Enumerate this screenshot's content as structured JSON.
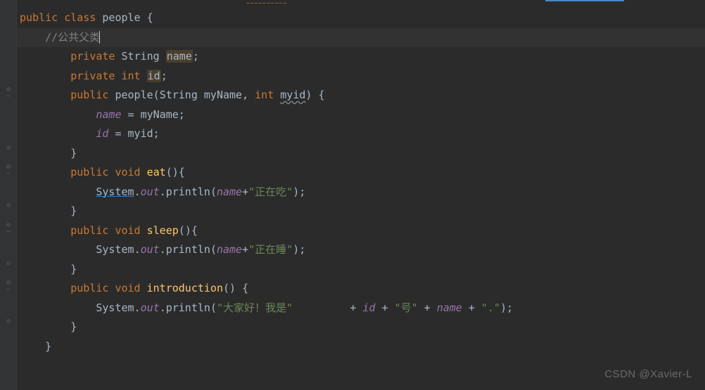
{
  "tokens": {
    "kw_public": "public",
    "kw_class": "class",
    "kw_private": "private",
    "kw_void": "void",
    "kw_int": "int",
    "cls_people": "people",
    "ty_string": "String",
    "fld_name": "name",
    "fld_id": "id",
    "p_myName": "myName",
    "p_myid": "myid",
    "m_eat": "eat",
    "m_sleep": "sleep",
    "m_intro": "introduction",
    "sys": "System",
    "out": "out",
    "println": "println",
    "comment_pub_parent": "//公共父类",
    "str_eating": "\"正在吃\"",
    "str_sleeping": "\"正在睡\"",
    "str_hello": "\"大家好！我是\"",
    "str_hao": "\"号\"",
    "str_dot": "\".\"",
    "brace_o": "{",
    "brace_c": "}",
    "paren_o": "(",
    "paren_c": ")",
    "semi": ";",
    "comma": ",",
    "dot": ".",
    "eq": "=",
    "plus": "+",
    "sp": " "
  },
  "watermark": "CSDN @Xavier-L",
  "code_lines": [
    {
      "indent": 0,
      "parts": [
        {
          "k": "kw_public",
          "c": "kw"
        },
        {
          "t": " "
        },
        {
          "k": "kw_class",
          "c": "kw"
        },
        {
          "t": " "
        },
        {
          "k": "cls_people",
          "c": "classname"
        },
        {
          "t": " "
        },
        {
          "k": "brace_o",
          "c": "punct"
        }
      ]
    },
    {
      "indent": 1,
      "hl": true,
      "parts": [
        {
          "k": "comment_pub_parent",
          "c": "comment"
        },
        {
          "t": "",
          "caret": true
        }
      ]
    },
    {
      "indent": 2,
      "parts": [
        {
          "k": "kw_private",
          "c": "kw"
        },
        {
          "t": " "
        },
        {
          "k": "ty_string",
          "c": "type"
        },
        {
          "t": " "
        },
        {
          "k": "fld_name",
          "c": "bg-highlight"
        },
        {
          "k": "semi",
          "c": "punct"
        }
      ]
    },
    {
      "indent": 2,
      "parts": [
        {
          "k": "kw_private",
          "c": "kw"
        },
        {
          "t": " "
        },
        {
          "k": "kw_int",
          "c": "kw"
        },
        {
          "t": " "
        },
        {
          "k": "fld_id",
          "c": "bg-highlight"
        },
        {
          "k": "semi",
          "c": "punct"
        }
      ]
    },
    {
      "indent": 2,
      "parts": [
        {
          "k": "kw_public",
          "c": "kw"
        },
        {
          "t": " "
        },
        {
          "k": "cls_people",
          "c": "classname"
        },
        {
          "k": "paren_o",
          "c": "punct"
        },
        {
          "k": "ty_string",
          "c": "type"
        },
        {
          "t": " "
        },
        {
          "k": "p_myName",
          "c": "param"
        },
        {
          "k": "comma",
          "c": "punct"
        },
        {
          "t": " "
        },
        {
          "k": "kw_int",
          "c": "kw"
        },
        {
          "t": " "
        },
        {
          "k": "p_myid",
          "c": "underline-wavy"
        },
        {
          "k": "paren_c",
          "c": "punct"
        },
        {
          "t": " "
        },
        {
          "k": "brace_o",
          "c": "punct"
        }
      ]
    },
    {
      "indent": 3,
      "parts": [
        {
          "k": "fld_name",
          "c": "field-italic"
        },
        {
          "t": " "
        },
        {
          "k": "eq",
          "c": "punct"
        },
        {
          "t": " "
        },
        {
          "k": "p_myName",
          "c": "param"
        },
        {
          "k": "semi",
          "c": "punct"
        }
      ]
    },
    {
      "indent": 3,
      "parts": [
        {
          "k": "fld_id",
          "c": "field-italic"
        },
        {
          "t": " "
        },
        {
          "k": "eq",
          "c": "punct"
        },
        {
          "t": " "
        },
        {
          "k": "p_myid",
          "c": "param"
        },
        {
          "k": "semi",
          "c": "punct"
        }
      ]
    },
    {
      "indent": 2,
      "parts": [
        {
          "k": "brace_c",
          "c": "punct"
        }
      ]
    },
    {
      "indent": 2,
      "parts": [
        {
          "k": "kw_public",
          "c": "kw"
        },
        {
          "t": " "
        },
        {
          "k": "kw_void",
          "c": "kw"
        },
        {
          "t": " "
        },
        {
          "k": "m_eat",
          "c": "method"
        },
        {
          "k": "paren_o",
          "c": "punct"
        },
        {
          "k": "paren_c",
          "c": "punct"
        },
        {
          "k": "brace_o",
          "c": "punct"
        }
      ]
    },
    {
      "indent": 3,
      "parts": [
        {
          "k": "sys",
          "c": "underline"
        },
        {
          "k": "dot",
          "c": "punct"
        },
        {
          "k": "out",
          "c": "field-italic"
        },
        {
          "k": "dot",
          "c": "punct"
        },
        {
          "k": "println",
          "c": "method-def"
        },
        {
          "k": "paren_o",
          "c": "punct"
        },
        {
          "k": "fld_name",
          "c": "field-italic"
        },
        {
          "k": "plus",
          "c": "punct"
        },
        {
          "k": "str_eating",
          "c": "str"
        },
        {
          "k": "paren_c",
          "c": "punct"
        },
        {
          "k": "semi",
          "c": "punct"
        }
      ]
    },
    {
      "indent": 2,
      "parts": [
        {
          "k": "brace_c",
          "c": "punct"
        }
      ]
    },
    {
      "indent": 2,
      "parts": [
        {
          "k": "kw_public",
          "c": "kw"
        },
        {
          "t": " "
        },
        {
          "k": "kw_void",
          "c": "kw"
        },
        {
          "t": " "
        },
        {
          "k": "m_sleep",
          "c": "method"
        },
        {
          "k": "paren_o",
          "c": "punct"
        },
        {
          "k": "paren_c",
          "c": "punct"
        },
        {
          "k": "brace_o",
          "c": "punct"
        }
      ]
    },
    {
      "indent": 3,
      "parts": [
        {
          "k": "sys",
          "c": "type"
        },
        {
          "k": "dot",
          "c": "punct"
        },
        {
          "k": "out",
          "c": "field-italic"
        },
        {
          "k": "dot",
          "c": "punct"
        },
        {
          "k": "println",
          "c": "method-def"
        },
        {
          "k": "paren_o",
          "c": "punct"
        },
        {
          "k": "fld_name",
          "c": "field-italic"
        },
        {
          "k": "plus",
          "c": "punct"
        },
        {
          "k": "str_sleeping",
          "c": "str"
        },
        {
          "k": "paren_c",
          "c": "punct"
        },
        {
          "k": "semi",
          "c": "punct"
        }
      ]
    },
    {
      "indent": 2,
      "parts": [
        {
          "k": "brace_c",
          "c": "punct"
        }
      ]
    },
    {
      "indent": 2,
      "parts": [
        {
          "k": "kw_public",
          "c": "kw"
        },
        {
          "t": " "
        },
        {
          "k": "kw_void",
          "c": "kw"
        },
        {
          "t": " "
        },
        {
          "k": "m_intro",
          "c": "method"
        },
        {
          "k": "paren_o",
          "c": "punct"
        },
        {
          "k": "paren_c",
          "c": "punct"
        },
        {
          "t": " "
        },
        {
          "k": "brace_o",
          "c": "punct"
        }
      ]
    },
    {
      "indent": 3,
      "parts": [
        {
          "k": "sys",
          "c": "type"
        },
        {
          "k": "dot",
          "c": "punct"
        },
        {
          "k": "out",
          "c": "field-italic"
        },
        {
          "k": "dot",
          "c": "punct"
        },
        {
          "k": "println",
          "c": "method-def"
        },
        {
          "k": "paren_o",
          "c": "punct"
        },
        {
          "k": "str_hello",
          "c": "str"
        },
        {
          "t": "         "
        },
        {
          "k": "plus",
          "c": "punct"
        },
        {
          "t": " "
        },
        {
          "k": "fld_id",
          "c": "field-italic"
        },
        {
          "t": " "
        },
        {
          "k": "plus",
          "c": "punct"
        },
        {
          "t": " "
        },
        {
          "k": "str_hao",
          "c": "str"
        },
        {
          "t": " "
        },
        {
          "k": "plus",
          "c": "punct"
        },
        {
          "t": " "
        },
        {
          "k": "fld_name",
          "c": "field-italic"
        },
        {
          "t": " "
        },
        {
          "k": "plus",
          "c": "punct"
        },
        {
          "t": " "
        },
        {
          "k": "str_dot",
          "c": "str"
        },
        {
          "k": "paren_c",
          "c": "punct"
        },
        {
          "k": "semi",
          "c": "punct"
        }
      ]
    },
    {
      "indent": 2,
      "parts": [
        {
          "k": "brace_c",
          "c": "punct"
        }
      ]
    },
    {
      "indent": 1,
      "parts": [
        {
          "k": "brace_c",
          "c": "punct"
        }
      ]
    }
  ],
  "fold_markers": [
    {
      "line": 4,
      "sym": "⊖"
    },
    {
      "line": 4,
      "sym": "—",
      "off": 1
    },
    {
      "line": 7,
      "sym": "⊝"
    },
    {
      "line": 8,
      "sym": "⊖"
    },
    {
      "line": 8,
      "sym": "—",
      "off": 1
    },
    {
      "line": 10,
      "sym": "⊝"
    },
    {
      "line": 11,
      "sym": "⊖"
    },
    {
      "line": 11,
      "sym": "—",
      "off": 1
    },
    {
      "line": 13,
      "sym": "⊝"
    },
    {
      "line": 14,
      "sym": "⊖"
    },
    {
      "line": 14,
      "sym": "—",
      "off": 1
    },
    {
      "line": 16,
      "sym": "⊝"
    }
  ]
}
